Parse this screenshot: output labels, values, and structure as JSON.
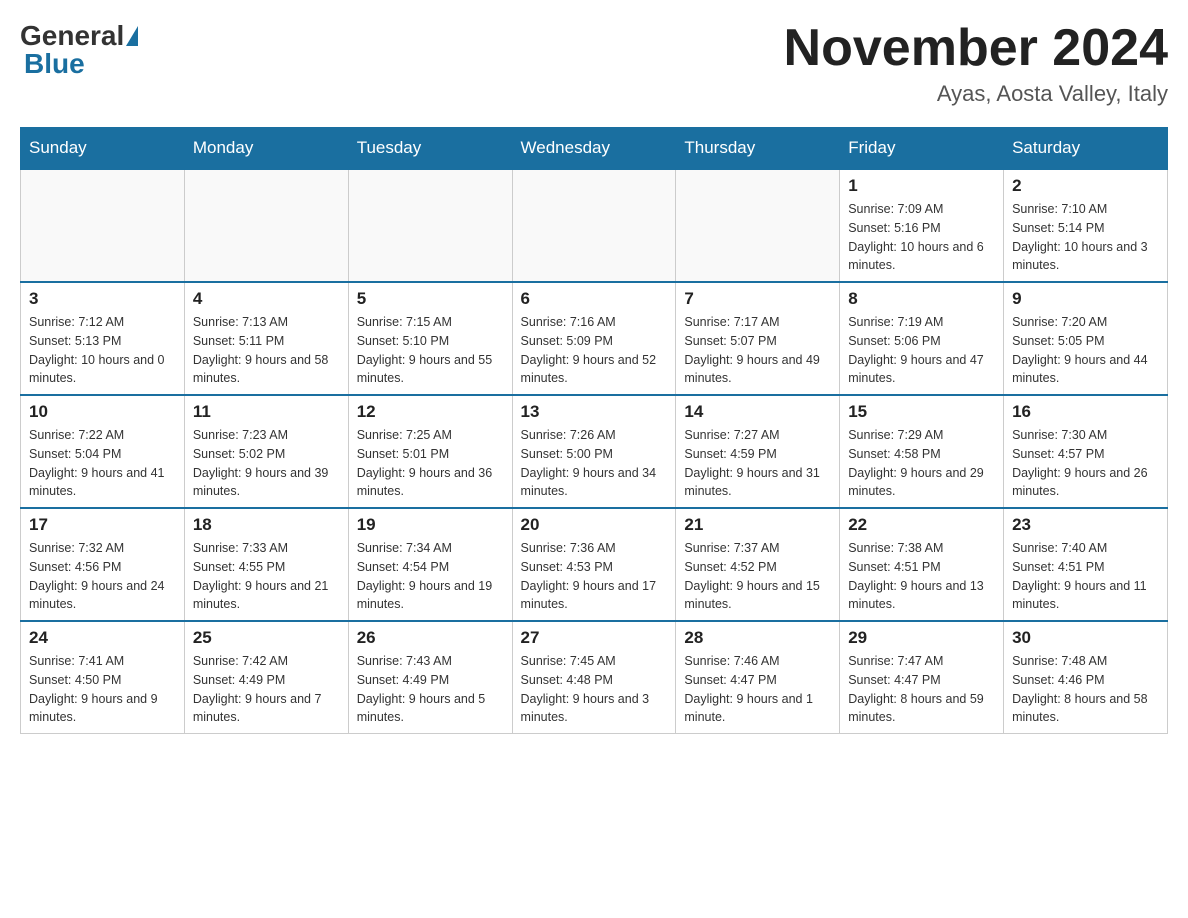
{
  "logo": {
    "general": "General",
    "blue": "Blue"
  },
  "title": "November 2024",
  "subtitle": "Ayas, Aosta Valley, Italy",
  "days_of_week": [
    "Sunday",
    "Monday",
    "Tuesday",
    "Wednesday",
    "Thursday",
    "Friday",
    "Saturday"
  ],
  "weeks": [
    [
      {
        "day": "",
        "info": ""
      },
      {
        "day": "",
        "info": ""
      },
      {
        "day": "",
        "info": ""
      },
      {
        "day": "",
        "info": ""
      },
      {
        "day": "",
        "info": ""
      },
      {
        "day": "1",
        "info": "Sunrise: 7:09 AM\nSunset: 5:16 PM\nDaylight: 10 hours and 6 minutes."
      },
      {
        "day": "2",
        "info": "Sunrise: 7:10 AM\nSunset: 5:14 PM\nDaylight: 10 hours and 3 minutes."
      }
    ],
    [
      {
        "day": "3",
        "info": "Sunrise: 7:12 AM\nSunset: 5:13 PM\nDaylight: 10 hours and 0 minutes."
      },
      {
        "day": "4",
        "info": "Sunrise: 7:13 AM\nSunset: 5:11 PM\nDaylight: 9 hours and 58 minutes."
      },
      {
        "day": "5",
        "info": "Sunrise: 7:15 AM\nSunset: 5:10 PM\nDaylight: 9 hours and 55 minutes."
      },
      {
        "day": "6",
        "info": "Sunrise: 7:16 AM\nSunset: 5:09 PM\nDaylight: 9 hours and 52 minutes."
      },
      {
        "day": "7",
        "info": "Sunrise: 7:17 AM\nSunset: 5:07 PM\nDaylight: 9 hours and 49 minutes."
      },
      {
        "day": "8",
        "info": "Sunrise: 7:19 AM\nSunset: 5:06 PM\nDaylight: 9 hours and 47 minutes."
      },
      {
        "day": "9",
        "info": "Sunrise: 7:20 AM\nSunset: 5:05 PM\nDaylight: 9 hours and 44 minutes."
      }
    ],
    [
      {
        "day": "10",
        "info": "Sunrise: 7:22 AM\nSunset: 5:04 PM\nDaylight: 9 hours and 41 minutes."
      },
      {
        "day": "11",
        "info": "Sunrise: 7:23 AM\nSunset: 5:02 PM\nDaylight: 9 hours and 39 minutes."
      },
      {
        "day": "12",
        "info": "Sunrise: 7:25 AM\nSunset: 5:01 PM\nDaylight: 9 hours and 36 minutes."
      },
      {
        "day": "13",
        "info": "Sunrise: 7:26 AM\nSunset: 5:00 PM\nDaylight: 9 hours and 34 minutes."
      },
      {
        "day": "14",
        "info": "Sunrise: 7:27 AM\nSunset: 4:59 PM\nDaylight: 9 hours and 31 minutes."
      },
      {
        "day": "15",
        "info": "Sunrise: 7:29 AM\nSunset: 4:58 PM\nDaylight: 9 hours and 29 minutes."
      },
      {
        "day": "16",
        "info": "Sunrise: 7:30 AM\nSunset: 4:57 PM\nDaylight: 9 hours and 26 minutes."
      }
    ],
    [
      {
        "day": "17",
        "info": "Sunrise: 7:32 AM\nSunset: 4:56 PM\nDaylight: 9 hours and 24 minutes."
      },
      {
        "day": "18",
        "info": "Sunrise: 7:33 AM\nSunset: 4:55 PM\nDaylight: 9 hours and 21 minutes."
      },
      {
        "day": "19",
        "info": "Sunrise: 7:34 AM\nSunset: 4:54 PM\nDaylight: 9 hours and 19 minutes."
      },
      {
        "day": "20",
        "info": "Sunrise: 7:36 AM\nSunset: 4:53 PM\nDaylight: 9 hours and 17 minutes."
      },
      {
        "day": "21",
        "info": "Sunrise: 7:37 AM\nSunset: 4:52 PM\nDaylight: 9 hours and 15 minutes."
      },
      {
        "day": "22",
        "info": "Sunrise: 7:38 AM\nSunset: 4:51 PM\nDaylight: 9 hours and 13 minutes."
      },
      {
        "day": "23",
        "info": "Sunrise: 7:40 AM\nSunset: 4:51 PM\nDaylight: 9 hours and 11 minutes."
      }
    ],
    [
      {
        "day": "24",
        "info": "Sunrise: 7:41 AM\nSunset: 4:50 PM\nDaylight: 9 hours and 9 minutes."
      },
      {
        "day": "25",
        "info": "Sunrise: 7:42 AM\nSunset: 4:49 PM\nDaylight: 9 hours and 7 minutes."
      },
      {
        "day": "26",
        "info": "Sunrise: 7:43 AM\nSunset: 4:49 PM\nDaylight: 9 hours and 5 minutes."
      },
      {
        "day": "27",
        "info": "Sunrise: 7:45 AM\nSunset: 4:48 PM\nDaylight: 9 hours and 3 minutes."
      },
      {
        "day": "28",
        "info": "Sunrise: 7:46 AM\nSunset: 4:47 PM\nDaylight: 9 hours and 1 minute."
      },
      {
        "day": "29",
        "info": "Sunrise: 7:47 AM\nSunset: 4:47 PM\nDaylight: 8 hours and 59 minutes."
      },
      {
        "day": "30",
        "info": "Sunrise: 7:48 AM\nSunset: 4:46 PM\nDaylight: 8 hours and 58 minutes."
      }
    ]
  ]
}
